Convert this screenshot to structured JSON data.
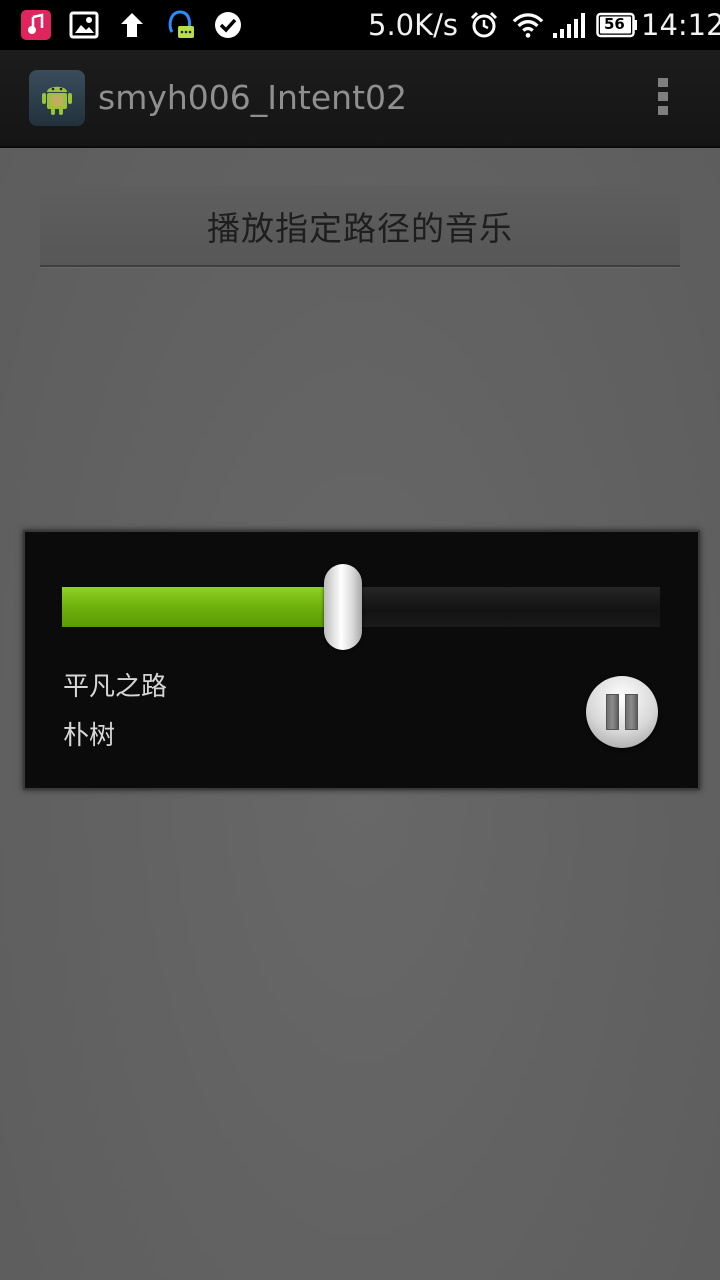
{
  "status_bar": {
    "net_speed": "5.0K/s",
    "battery": "56",
    "time": "14:12",
    "icons": [
      "music-notification-icon",
      "image-notification-icon",
      "upload-arrow-icon",
      "qq-message-icon",
      "check-circle-icon",
      "alarm-icon",
      "wifi-icon",
      "signal-icon",
      "battery-icon"
    ]
  },
  "action_bar": {
    "title": "smyh006_Intent02",
    "app_icon": "android-app-icon",
    "menu_icon": "overflow-menu-icon"
  },
  "main": {
    "play_button_label": "播放指定路径的音乐"
  },
  "player": {
    "progress": 0.47,
    "progress_color": "#7cc01a",
    "song_title": "平凡之路",
    "artist": "朴树",
    "pause_icon": "pause-icon"
  }
}
